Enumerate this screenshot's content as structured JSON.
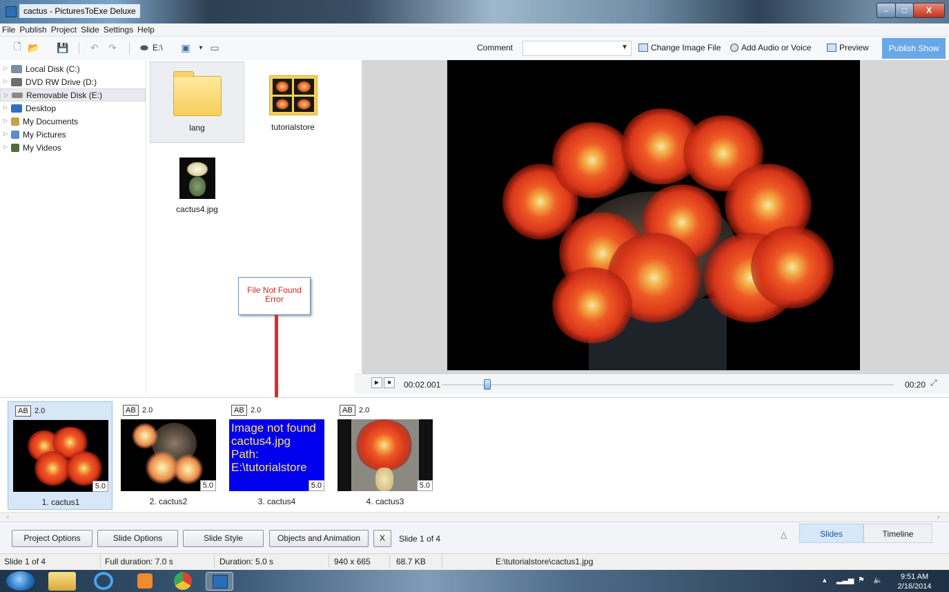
{
  "window": {
    "title": "cactus - PicturesToExe Deluxe",
    "minimize": "–",
    "maximize": "□",
    "close": "X"
  },
  "menu": [
    "File",
    "Publish",
    "Project",
    "Slide",
    "Settings",
    "Help"
  ],
  "toolbar": {
    "drive_label": "E:\\",
    "comment_label": "Comment",
    "comment_value": "",
    "comment_dropdown_arrow": "▼",
    "change_image": "Change Image File",
    "add_audio": "Add Audio or Voice",
    "preview": "Preview",
    "publish": "Publish Show",
    "icons": {
      "new": "🗋",
      "open": "📂",
      "save": "💾",
      "undo": "↶",
      "redo": "↷",
      "drive": "⬬",
      "view": "▣",
      "view_arrow": "▾",
      "disk": "▭"
    }
  },
  "tree": {
    "expander": "▷",
    "items": [
      {
        "label": "Local Disk (C:)",
        "color": "#7a8fa6"
      },
      {
        "label": "DVD RW Drive (D:)",
        "color": "#6d6d6d"
      },
      {
        "label": "Removable Disk (E:)",
        "color": "#8a8a8a"
      },
      {
        "label": "Desktop",
        "color": "#2f6fc0"
      },
      {
        "label": "My Documents",
        "color": "#c9a04a"
      },
      {
        "label": "My Pictures",
        "color": "#5b8dc8"
      },
      {
        "label": "My Videos",
        "color": "#4f6d3a"
      }
    ]
  },
  "files": [
    {
      "label": "lang"
    },
    {
      "label": "tutorialstore"
    },
    {
      "label": "cactus4.jpg"
    }
  ],
  "callout": {
    "line1": "File Not Found",
    "line2": "Error"
  },
  "playback": {
    "play": "▶",
    "stop": "■",
    "current_time": "00:02.001",
    "end_time": "00:20",
    "position_fraction": 0.1,
    "fullscreen": "⤢"
  },
  "slides": [
    {
      "ab": "AB",
      "transition": "2.0",
      "duration": "5.0",
      "label": "1. cactus1",
      "selected": true
    },
    {
      "ab": "AB",
      "transition": "2.0",
      "duration": "5.0",
      "label": "2. cactus2"
    },
    {
      "ab": "AB",
      "transition": "2.0",
      "duration": "5.0",
      "label": "3. cactus4",
      "error_lines": [
        "Image not found",
        "cactus4.jpg",
        "Path:",
        "E:\\tutorialstore"
      ]
    },
    {
      "ab": "AB",
      "transition": "2.0",
      "duration": "5.0",
      "label": "4. cactus3"
    }
  ],
  "scrollbar": {
    "left": "‹",
    "right": "›"
  },
  "buttons": {
    "project_options": "Project Options",
    "slide_options": "Slide Options",
    "slide_style": "Slide Style",
    "objects_animation": "Objects and Animation",
    "close_x": "X",
    "slide_counter": "Slide 1 of 4",
    "triangle": "△"
  },
  "tabs": {
    "slides": "Slides",
    "timeline": "Timeline"
  },
  "status": {
    "slide": "Slide 1 of 4",
    "full_duration": "Full duration: 7.0 s",
    "duration": "Duration: 5.0 s",
    "resolution": "940 x 665",
    "size": "68.7 KB",
    "path": "E:\\tutorialstore\\cactus1.jpg"
  },
  "taskbar": {
    "time": "9:51 AM",
    "date": "2/16/2014",
    "tray_up": "▴",
    "tray_signal": "▂▃▅",
    "tray_flag": "⚑",
    "tray_volume": "🔈"
  }
}
